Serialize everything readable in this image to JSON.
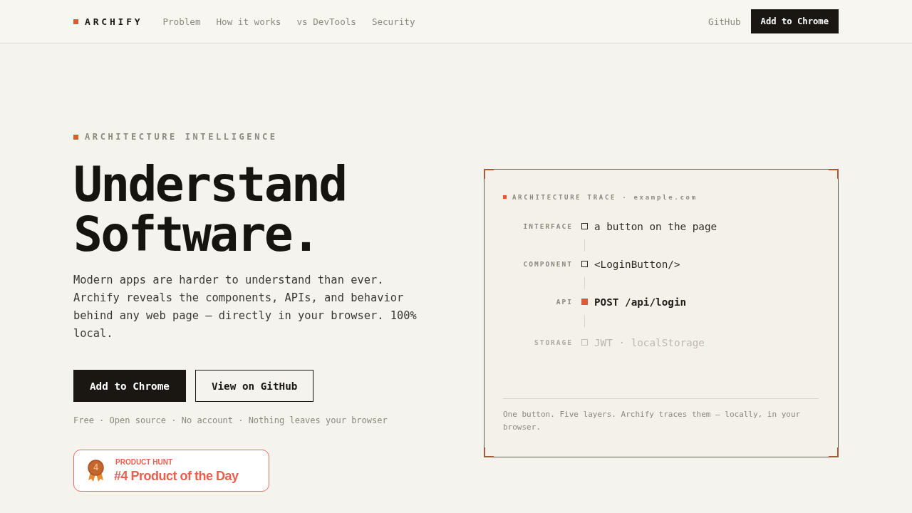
{
  "nav": {
    "logo": "ARCHIFY",
    "links": [
      "Problem",
      "How it works",
      "vs DevTools",
      "Security"
    ],
    "github_link": "GitHub",
    "cta_button": "Add to Chrome"
  },
  "hero": {
    "eyebrow": "ARCHITECTURE INTELLIGENCE",
    "heading": "Understand Software.",
    "description": "Modern apps are harder to understand than ever. Archify reveals the components, APIs, and behavior behind any web page — directly in your browser. 100% local.",
    "buttons": [
      {
        "label": "Add to Chrome",
        "kind": "primary"
      },
      {
        "label": "View on GitHub",
        "kind": "secondary"
      }
    ],
    "meta": "Free · Open source · No account · Nothing leaves your browser",
    "badge": {
      "rank": "4",
      "eyebrow": "PRODUCT HUNT",
      "title": "#4 Product of the Day"
    }
  },
  "trace": {
    "header": "ARCHITECTURE TRACE · example.com",
    "layers": [
      {
        "label": "INTERFACE",
        "value": "a button on the page",
        "active": false,
        "dimmed": false
      },
      {
        "label": "COMPONENT",
        "value": "<LoginButton/>",
        "active": false,
        "dimmed": false
      },
      {
        "label": "API",
        "value": "POST /api/login",
        "active": true,
        "dimmed": false
      },
      {
        "label": "STORAGE",
        "value": "JWT · localStorage",
        "active": false,
        "dimmed": true
      }
    ],
    "footnote": "One button. Five layers. Archify traces them — locally, in your browser."
  }
}
